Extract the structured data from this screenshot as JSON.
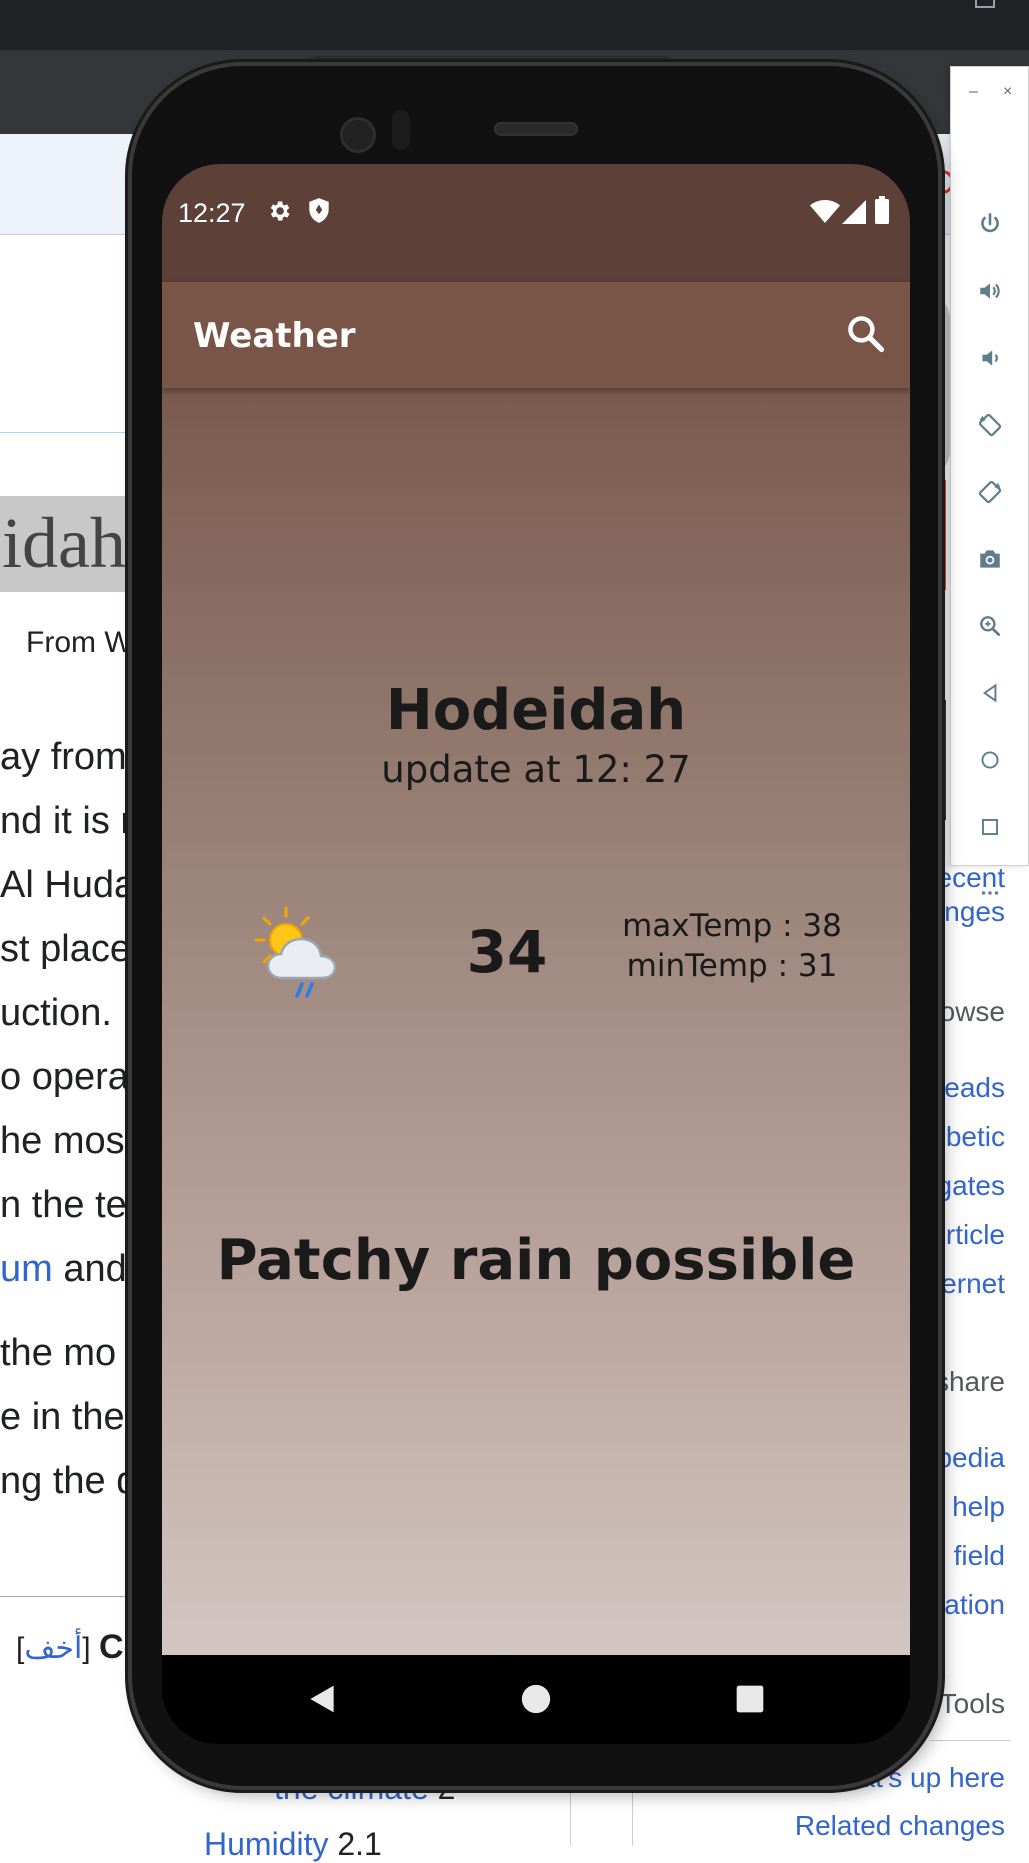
{
  "wiki": {
    "title_fragment": "eidah",
    "from_fragment": "From W",
    "lines": [
      {
        "text": "ay from"
      },
      {
        "text": "nd it is ra"
      },
      {
        "text": " Al Huda"
      },
      {
        "text": "st place "
      },
      {
        "text": "uction. F"
      },
      {
        "text": "o opera"
      },
      {
        "text": "he most"
      },
      {
        "text": "n the ter"
      },
      {
        "link": "um",
        "text": " and s"
      },
      {
        "text": " the mo"
      },
      {
        "text": "e in the"
      },
      {
        "text": "ng the d"
      }
    ],
    "hide_label": "أخف",
    "contents_fragment": "Co",
    "toc": [
      {
        "label": "the climate",
        "num": "2"
      },
      {
        "label": "Humidity",
        "num": "2.1"
      }
    ],
    "sidebar": {
      "recent": "ecent",
      "changes": "nges",
      "browse": "owse",
      "links1": [
        "reads",
        "betic",
        "gates",
        "rticle",
        "ernet"
      ],
      "share": "share",
      "links2": [
        "pedia",
        "help",
        "field",
        "ation"
      ],
      "tools": "Tools",
      "links3": [
        "at's up here",
        "Related changes"
      ]
    }
  },
  "phone": {
    "status_bar": {
      "time": "12:27"
    },
    "app_bar": {
      "title": "Weather"
    },
    "weather": {
      "city": "Hodeidah",
      "updated": "update at 12: 27",
      "temp": "34",
      "max_temp": "maxTemp : 38",
      "min_temp": "minTemp : 31",
      "condition": "Patchy rain possible",
      "icon": "patchy-rain-icon"
    }
  },
  "colors": {
    "status_bar": "#5d4037",
    "app_bar": "#795548",
    "gradient_top": "#7a5a4e",
    "gradient_bottom": "#d3c6c2",
    "wiki_link": "#3366cc"
  },
  "emulator_toolbar": {
    "buttons": [
      "power-icon",
      "volume-up-icon",
      "volume-down-icon",
      "rotate-left-icon",
      "rotate-right-icon",
      "camera-icon",
      "zoom-icon",
      "back-icon",
      "home-icon",
      "overview-icon",
      "more-icon"
    ]
  }
}
